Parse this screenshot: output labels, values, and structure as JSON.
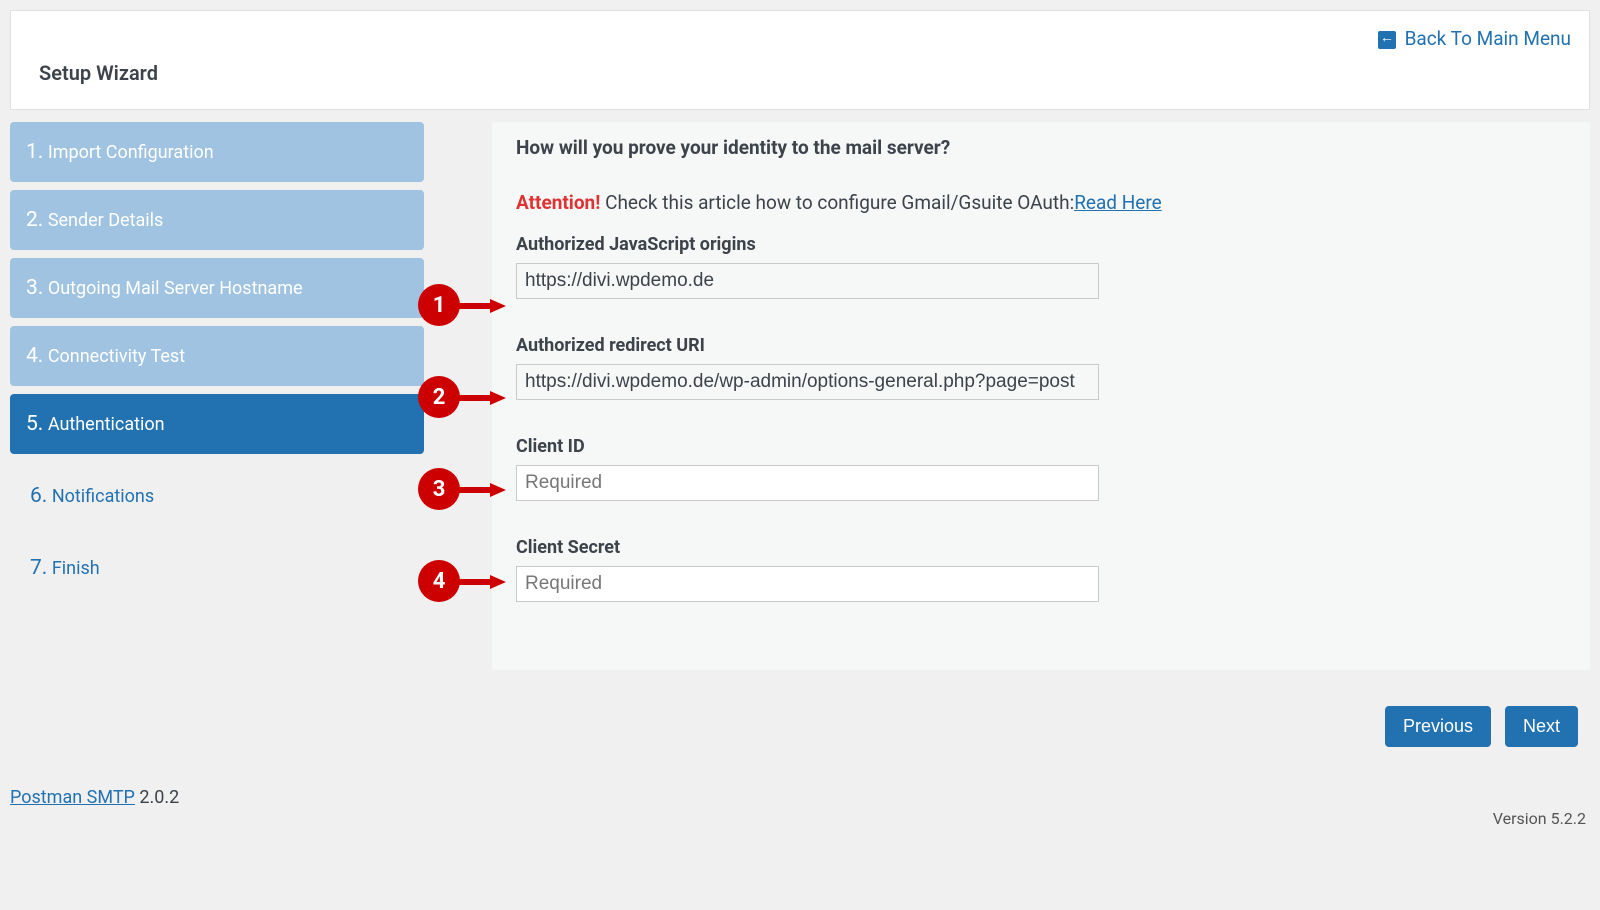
{
  "header": {
    "back_link": "Back To Main Menu",
    "title": "Setup Wizard"
  },
  "steps": [
    {
      "num": "1.",
      "label": "Import Configuration",
      "state": "inactive"
    },
    {
      "num": "2.",
      "label": "Sender Details",
      "state": "inactive"
    },
    {
      "num": "3.",
      "label": "Outgoing Mail Server Hostname",
      "state": "inactive"
    },
    {
      "num": "4.",
      "label": "Connectivity Test",
      "state": "inactive"
    },
    {
      "num": "5.",
      "label": "Authentication",
      "state": "active"
    },
    {
      "num": "6.",
      "label": "Notifications",
      "state": "plain"
    },
    {
      "num": "7.",
      "label": "Finish",
      "state": "plain"
    }
  ],
  "content": {
    "heading": "How will you prove your identity to the mail server?",
    "attention_label": "Attention!",
    "attention_text": " Check this article how to configure Gmail/Gsuite OAuth:",
    "attention_link": "Read Here",
    "fields": {
      "js_origins": {
        "label": "Authorized JavaScript origins",
        "value": "https://divi.wpdemo.de"
      },
      "redirect_uri": {
        "label": "Authorized redirect URI",
        "value": "https://divi.wpdemo.de/wp-admin/options-general.php?page=post"
      },
      "client_id": {
        "label": "Client ID",
        "placeholder": "Required"
      },
      "client_secret": {
        "label": "Client Secret",
        "placeholder": "Required"
      }
    }
  },
  "annotations": [
    "1",
    "2",
    "3",
    "4"
  ],
  "buttons": {
    "prev": "Previous",
    "next": "Next"
  },
  "footer": {
    "link": "Postman SMTP",
    "ver1": " 2.0.2",
    "ver2": "Version 5.2.2"
  },
  "colors": {
    "accent": "#2271b1",
    "danger": "#d33",
    "callout": "#cc0000"
  }
}
